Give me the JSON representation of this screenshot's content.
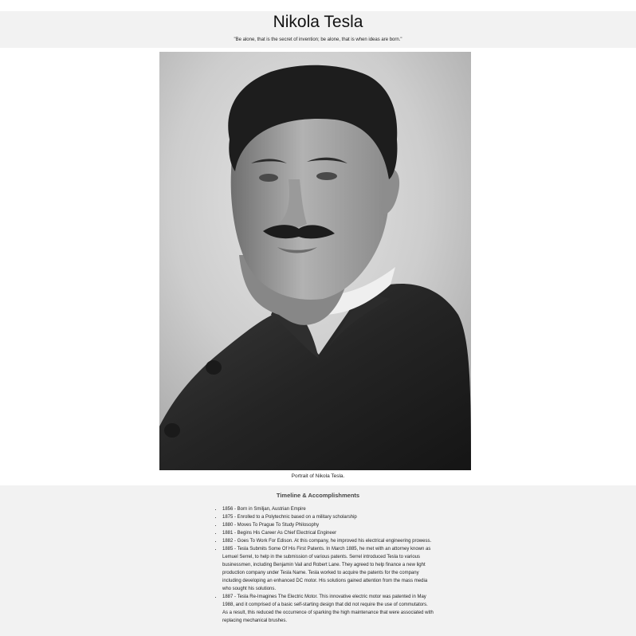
{
  "header": {
    "title": "Nikola Tesla",
    "quote": "\"Be alone, that is the secret of invention; be alone, that is when ideas are born.\""
  },
  "figure": {
    "caption": "Portrait of Nikola Tesla."
  },
  "timeline": {
    "heading": "Timeline & Accomplishments",
    "items": [
      {
        "text": "1856 - Born in Smiljan, Austrian Empire"
      },
      {
        "text": "1875 - Enrolled to a Polytechnic based on a military scholarship"
      },
      {
        "text": "1880 - Moves To Prague To Study Philosophy"
      },
      {
        "text": "1881 - Begins His Career As Chief Electrical Engineer"
      },
      {
        "text": "1882 - Goes To Work For Edison. At this company, he improved his electrical engineering prowess."
      },
      {
        "text": "1885 - Tesla Submits Some Of His First Patents. In March 1885, he met with an attorney known as Lemuel Serrel, to help in the submission of various patents. Serrel introduced Tesla to various businessmen, including Benjamin Vail and Robert Lane. They agreed to help finance a new light production company under Tesla Name. Tesla worked to acquire the patents for the company including developing an enhanced DC motor. His solutions gained attention from the mass media who sought his solutions."
      },
      {
        "text": "1887 - Tesla Re-Imagines The Electric Motor. This innovative electric motor was patented in May 1988, and it comprised of a basic self-starting design that did not require the use of commutators. As a result, this reduced the occurrence of sparking the high maintenance that were associated with replacing mechanical brushes."
      }
    ]
  }
}
